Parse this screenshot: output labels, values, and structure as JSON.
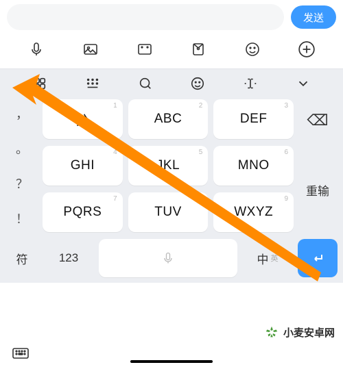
{
  "top": {
    "send_label": "发送"
  },
  "chat_toolbar": {
    "icons": [
      "mic-icon",
      "gallery-icon",
      "gif-icon",
      "redpacket-icon",
      "emoji-icon",
      "plus-icon"
    ]
  },
  "utility_row": {
    "icons": [
      "apps-icon",
      "keyboard-style-icon",
      "search-icon",
      "smiley-icon",
      "cursor-icon",
      "chevron-down-icon"
    ]
  },
  "punct_column": [
    "，",
    "。",
    "？",
    "！"
  ],
  "keys": {
    "row1": [
      {
        "sup": "1",
        "main": "分"
      },
      {
        "sup": "2",
        "main": "ABC"
      },
      {
        "sup": "3",
        "main": "DEF"
      }
    ],
    "row2": [
      {
        "sup": "4",
        "main": "GHI"
      },
      {
        "sup": "5",
        "main": "JKL"
      },
      {
        "sup": "6",
        "main": "MNO"
      }
    ],
    "row3": [
      {
        "sup": "7",
        "main": "PQRS"
      },
      {
        "sup": "8",
        "main": "TUV"
      },
      {
        "sup": "9",
        "main": "WXYZ"
      }
    ]
  },
  "right_column": {
    "backspace_label": "⌫",
    "reinput_label": "重输"
  },
  "bottom_row": {
    "symbol_label": "符",
    "numeric_label": "123",
    "lang_primary": "中",
    "lang_secondary": "英",
    "enter_label": "↵"
  },
  "watermark": {
    "text": "小麦安卓网"
  },
  "colors": {
    "accent": "#3b9aff",
    "arrow": "#ff8a00",
    "keyboard_bg": "#eceef2"
  }
}
